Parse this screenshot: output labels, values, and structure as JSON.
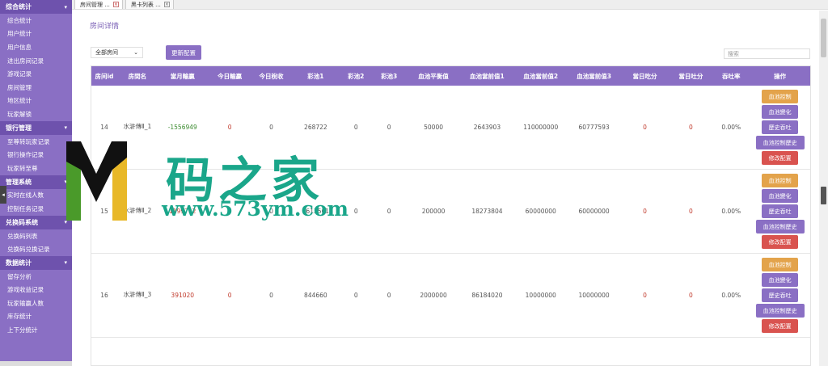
{
  "sidebar": {
    "sections": [
      {
        "title": "综合统计",
        "items": [
          "综合统计",
          "用户统计",
          "用户信息",
          "进出房间记录",
          "游戏记录",
          "房间管理",
          "地区统计",
          "玩家解锁"
        ]
      },
      {
        "title": "银行管理",
        "items": [
          "至尊转玩家记录",
          "银行操作记录",
          "玩家转至尊"
        ]
      },
      {
        "title": "管理系统",
        "items": [
          "实时在线人数",
          "控制任务记录"
        ]
      },
      {
        "title": "兑换码系统",
        "items": [
          "兑换码列表",
          "兑换码兑换记录"
        ]
      },
      {
        "title": "数据统计",
        "items": [
          "留存分析",
          "游戏收益记录",
          "玩家输赢人数",
          "库存统计",
          "上下分统计"
        ]
      }
    ]
  },
  "tabs": [
    {
      "label": "房间管理 ..."
    },
    {
      "label": "黑卡列表 ..."
    }
  ],
  "page": {
    "title": "房间详情",
    "select_value": "全部房间",
    "update_button": "更新配置",
    "search_placeholder": "搜索"
  },
  "table": {
    "headers": [
      "房间id",
      "房間名",
      "當月輸贏",
      "今日輸贏",
      "今日稅收",
      "彩池1",
      "彩池2",
      "彩池3",
      "血池平衡值",
      "血池當前值1",
      "血池當前值2",
      "血池當前值3",
      "當日吃分",
      "當日吐分",
      "吞吐率",
      "操作"
    ],
    "rows": [
      {
        "id": "14",
        "name": "水滸傳Ⅱ_1",
        "month": "-1556949",
        "today": "0",
        "tax": "0",
        "pool1": "268722",
        "pool2": "0",
        "pool3": "0",
        "balance": "50000",
        "cur1": "2643903",
        "cur2": "110000000",
        "cur3": "60777593",
        "eat": "0",
        "spit": "0",
        "rate": "0.00%"
      },
      {
        "id": "15",
        "name": "水滸傳Ⅱ_2",
        "month": "1199712",
        "today": "0",
        "tax": "0",
        "pool1": "1613561",
        "pool2": "0",
        "pool3": "0",
        "balance": "200000",
        "cur1": "18273804",
        "cur2": "60000000",
        "cur3": "60000000",
        "eat": "0",
        "spit": "0",
        "rate": "0.00%"
      },
      {
        "id": "16",
        "name": "水滸傳Ⅱ_3",
        "month": "391020",
        "today": "0",
        "tax": "0",
        "pool1": "844660",
        "pool2": "0",
        "pool3": "0",
        "balance": "2000000",
        "cur1": "86184020",
        "cur2": "10000000",
        "cur3": "10000000",
        "eat": "0",
        "spit": "0",
        "rate": "0.00%"
      }
    ],
    "ops": [
      "血池控制",
      "血池變化",
      "歷史吞吐",
      "血池控制歷史",
      "修改配置"
    ]
  },
  "watermark": {
    "text": "码之家",
    "url": "www.573ym.com"
  },
  "colors": {
    "accent": "#8a6fc4",
    "sidebar_header": "#6e52ad",
    "orange": "#e3a34b",
    "red": "#d9534f",
    "watermark": "#1aa68a"
  }
}
